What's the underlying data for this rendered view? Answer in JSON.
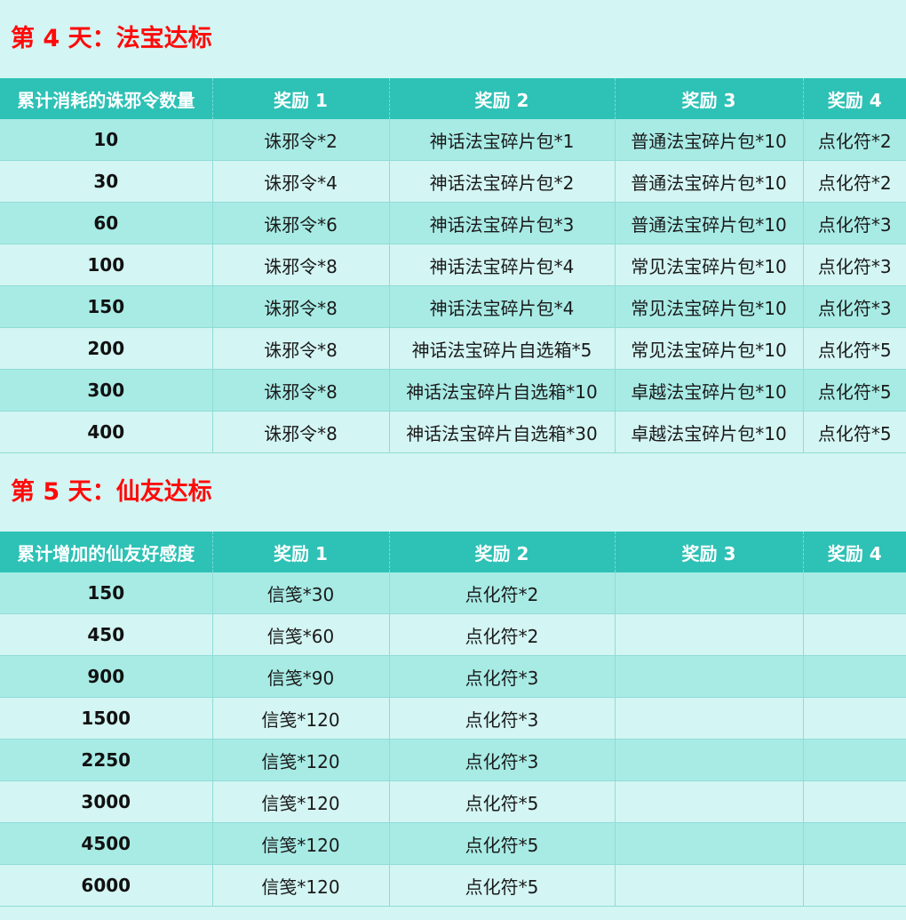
{
  "sections": [
    {
      "title": "第 4 天：法宝达标",
      "headers": [
        "累计消耗的诛邪令数量",
        "奖励 1",
        "奖励 2",
        "奖励 3",
        "奖励 4"
      ],
      "rows": [
        [
          "10",
          "诛邪令*2",
          "神话法宝碎片包*1",
          "普通法宝碎片包*10",
          "点化符*2"
        ],
        [
          "30",
          "诛邪令*4",
          "神话法宝碎片包*2",
          "普通法宝碎片包*10",
          "点化符*2"
        ],
        [
          "60",
          "诛邪令*6",
          "神话法宝碎片包*3",
          "普通法宝碎片包*10",
          "点化符*3"
        ],
        [
          "100",
          "诛邪令*8",
          "神话法宝碎片包*4",
          "常见法宝碎片包*10",
          "点化符*3"
        ],
        [
          "150",
          "诛邪令*8",
          "神话法宝碎片包*4",
          "常见法宝碎片包*10",
          "点化符*3"
        ],
        [
          "200",
          "诛邪令*8",
          "神话法宝碎片自选箱*5",
          "常见法宝碎片包*10",
          "点化符*5"
        ],
        [
          "300",
          "诛邪令*8",
          "神话法宝碎片自选箱*10",
          "卓越法宝碎片包*10",
          "点化符*5"
        ],
        [
          "400",
          "诛邪令*8",
          "神话法宝碎片自选箱*30",
          "卓越法宝碎片包*10",
          "点化符*5"
        ]
      ]
    },
    {
      "title": "第 5 天：仙友达标",
      "headers": [
        "累计增加的仙友好感度",
        "奖励 1",
        "奖励 2",
        "奖励 3",
        "奖励 4"
      ],
      "rows": [
        [
          "150",
          "信笺*30",
          "点化符*2",
          "",
          ""
        ],
        [
          "450",
          "信笺*60",
          "点化符*2",
          "",
          ""
        ],
        [
          "900",
          "信笺*90",
          "点化符*3",
          "",
          ""
        ],
        [
          "1500",
          "信笺*120",
          "点化符*3",
          "",
          ""
        ],
        [
          "2250",
          "信笺*120",
          "点化符*3",
          "",
          ""
        ],
        [
          "3000",
          "信笺*120",
          "点化符*5",
          "",
          ""
        ],
        [
          "4500",
          "信笺*120",
          "点化符*5",
          "",
          ""
        ],
        [
          "6000",
          "信笺*120",
          "点化符*5",
          "",
          ""
        ]
      ]
    }
  ]
}
